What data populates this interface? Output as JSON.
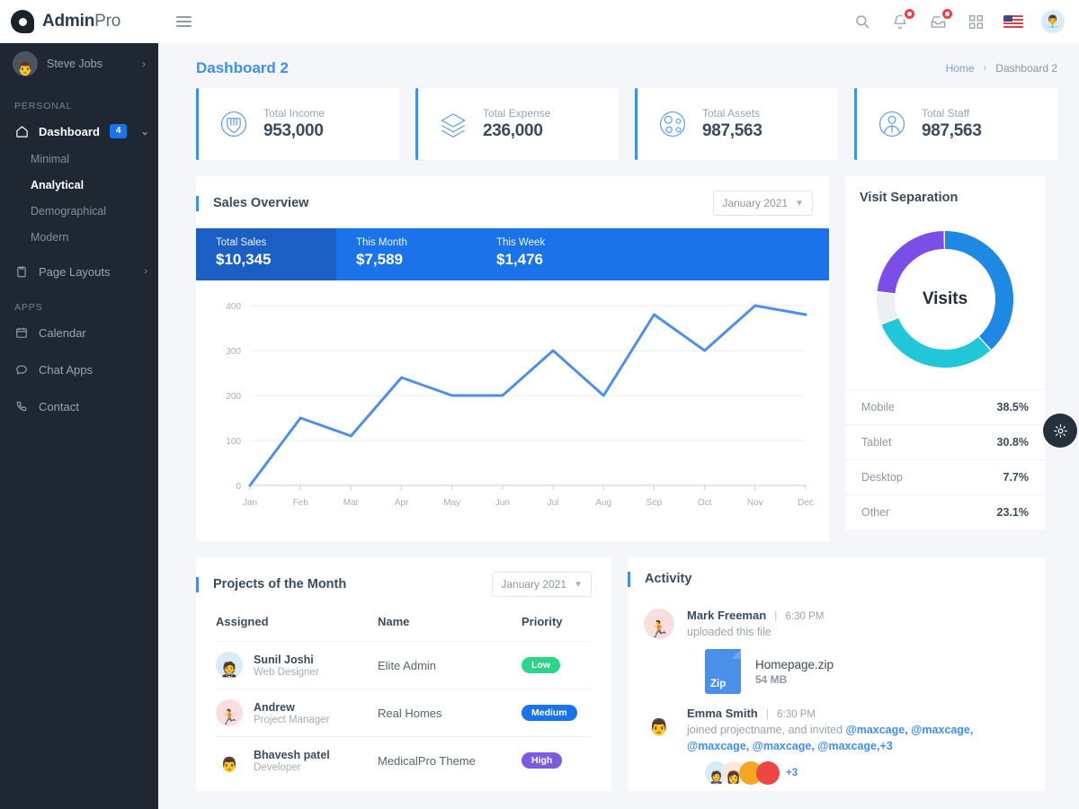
{
  "brand": {
    "bold": "Admin",
    "light": "Pro"
  },
  "topbar": {
    "search_icon": "search-icon",
    "bell_icon": "bell-icon",
    "message_icon": "message-icon",
    "grid_icon": "grid-icon",
    "flag_icon": "us-flag-icon",
    "avatar_icon": "user-avatar"
  },
  "sidebar": {
    "user": {
      "name": "Steve Jobs"
    },
    "sections": [
      {
        "label": "PERSONAL",
        "items": [
          {
            "label": "Dashboard",
            "icon": "home-icon",
            "badge": "4",
            "arrow": "chevron-down",
            "active": true,
            "children": [
              {
                "label": "Minimal",
                "active": false
              },
              {
                "label": "Analytical",
                "active": true
              },
              {
                "label": "Demographical",
                "active": false
              },
              {
                "label": "Modern",
                "active": false
              }
            ]
          },
          {
            "label": "Page Layouts",
            "icon": "clipboard-icon",
            "arrow": "chevron-right",
            "active": false
          }
        ]
      },
      {
        "label": "APPS",
        "items": [
          {
            "label": "Calendar",
            "icon": "calendar-icon",
            "active": false
          },
          {
            "label": "Chat Apps",
            "icon": "chat-icon",
            "active": false
          },
          {
            "label": "Contact",
            "icon": "phone-icon",
            "active": false
          }
        ]
      }
    ]
  },
  "page": {
    "title": "Dashboard 2",
    "breadcrumb": {
      "home": "Home",
      "sep": "›",
      "current": "Dashboard 2"
    }
  },
  "stats": [
    {
      "label": "Total Income",
      "value": "953,000",
      "icon": "shield-heart-icon"
    },
    {
      "label": "Total Expense",
      "value": "236,000",
      "icon": "layers-icon"
    },
    {
      "label": "Total Assets",
      "value": "987,563",
      "icon": "globe-gear-icon"
    },
    {
      "label": "Total Staff",
      "value": "987,563",
      "icon": "staff-icon"
    }
  ],
  "sales": {
    "title": "Sales Overview",
    "period": "January 2021",
    "cells": [
      {
        "label": "Total Sales",
        "value": "$10,345",
        "dark": true
      },
      {
        "label": "This Month",
        "value": "$7,589",
        "dark": false
      },
      {
        "label": "This Week",
        "value": "$1,476",
        "dark": false
      }
    ]
  },
  "visits": {
    "title": "Visit Separation",
    "center_label": "Visits",
    "legend": [
      {
        "name": "Mobile",
        "value": "38.5%"
      },
      {
        "name": "Tablet",
        "value": "30.8%"
      },
      {
        "name": "Desktop",
        "value": "7.7%"
      },
      {
        "name": "Other",
        "value": "23.1%"
      }
    ]
  },
  "projects": {
    "title": "Projects of the Month",
    "period": "January 2021",
    "columns": [
      "Assigned",
      "Name",
      "Priority"
    ],
    "rows": [
      {
        "name": "Sunil Joshi",
        "role": "Web Designer",
        "project": "Elite Admin",
        "priority": "Low",
        "priority_color": "#2bd58b",
        "avatar_bg": "#d6ecf8",
        "glyph": "🧑‍💼"
      },
      {
        "name": "Andrew",
        "role": "Project Manager",
        "project": "Real Homes",
        "priority": "Medium",
        "priority_color": "#1a73e8",
        "avatar_bg": "#fadedd",
        "glyph": "🏃"
      },
      {
        "name": "Bhavesh patel",
        "role": "Developer",
        "project": "MedicalPro Theme",
        "priority": "High",
        "priority_color": "#7b5ce0",
        "avatar_bg": "#ffffff",
        "glyph": "👨"
      }
    ]
  },
  "activity": {
    "title": "Activity",
    "items": [
      {
        "name": "Mark Freeman",
        "sep": "|",
        "time": "6:30 PM",
        "text": "uploaded this file",
        "avatar_bg": "#fadedd",
        "glyph": "🏃",
        "file": {
          "type": "Zip",
          "name": "Homepage.zip",
          "size": "54 MB"
        }
      },
      {
        "name": "Emma Smith",
        "sep": "|",
        "time": "6:30 PM",
        "text_prefix": "joined projectname, and invited ",
        "mentions": "@maxcage, @maxcage, @maxcage, @maxcage, @maxcage,+3",
        "avatar_bg": "#ffffff",
        "glyph": "👨",
        "stack_more": "+3",
        "stack": [
          {
            "bg": "#d6ecf8",
            "glyph": "🧑‍💼"
          },
          {
            "bg": "#fbe9d7",
            "glyph": "👩"
          },
          {
            "bg": "#f5a623",
            "glyph": ""
          },
          {
            "bg": "#ef4444",
            "glyph": ""
          }
        ]
      }
    ]
  },
  "fab": {
    "icon": "gear-icon"
  },
  "chart_data": {
    "type": "line",
    "title": "Sales Overview",
    "categories": [
      "Jan",
      "Feb",
      "Mar",
      "Apr",
      "May",
      "Jun",
      "Jul",
      "Aug",
      "Sep",
      "Oct",
      "Nov",
      "Dec"
    ],
    "values": [
      0,
      150,
      110,
      240,
      200,
      200,
      300,
      200,
      380,
      300,
      400,
      380
    ],
    "yticks": [
      0,
      100,
      200,
      300,
      400
    ],
    "ylim": [
      0,
      420
    ],
    "xlabel": "",
    "ylabel": "",
    "grid": true,
    "legend": "none",
    "series_color": "#4c8ff0"
  },
  "donut_data": {
    "type": "pie",
    "title": "Visit Separation",
    "categories": [
      "Mobile",
      "Tablet",
      "Desktop",
      "Other"
    ],
    "values": [
      38.5,
      30.8,
      7.7,
      23.1
    ],
    "colors": [
      "#1e88e5",
      "#21c7d8",
      "#eceff3",
      "#7b4ee8"
    ],
    "center_label": "Visits"
  }
}
